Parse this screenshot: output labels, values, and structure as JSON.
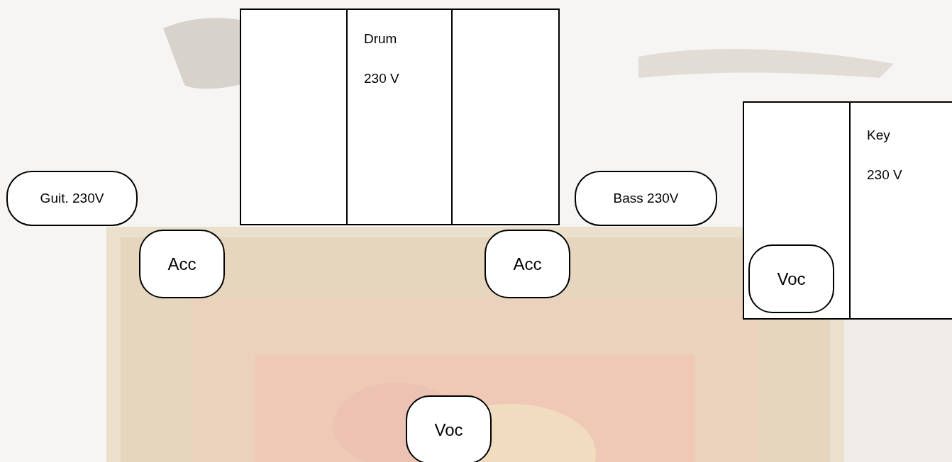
{
  "drum_riser": {
    "label": "Drum",
    "power": "230 V"
  },
  "keyboard_riser": {
    "label": "Key",
    "power": "230 V"
  },
  "amps": [
    {
      "label": "Guit. 230V"
    },
    {
      "label": "Bass 230V"
    }
  ],
  "mics": [
    {
      "label": "Acc"
    },
    {
      "label": "Acc"
    },
    {
      "label": "Voc"
    },
    {
      "label": "Voc"
    }
  ]
}
